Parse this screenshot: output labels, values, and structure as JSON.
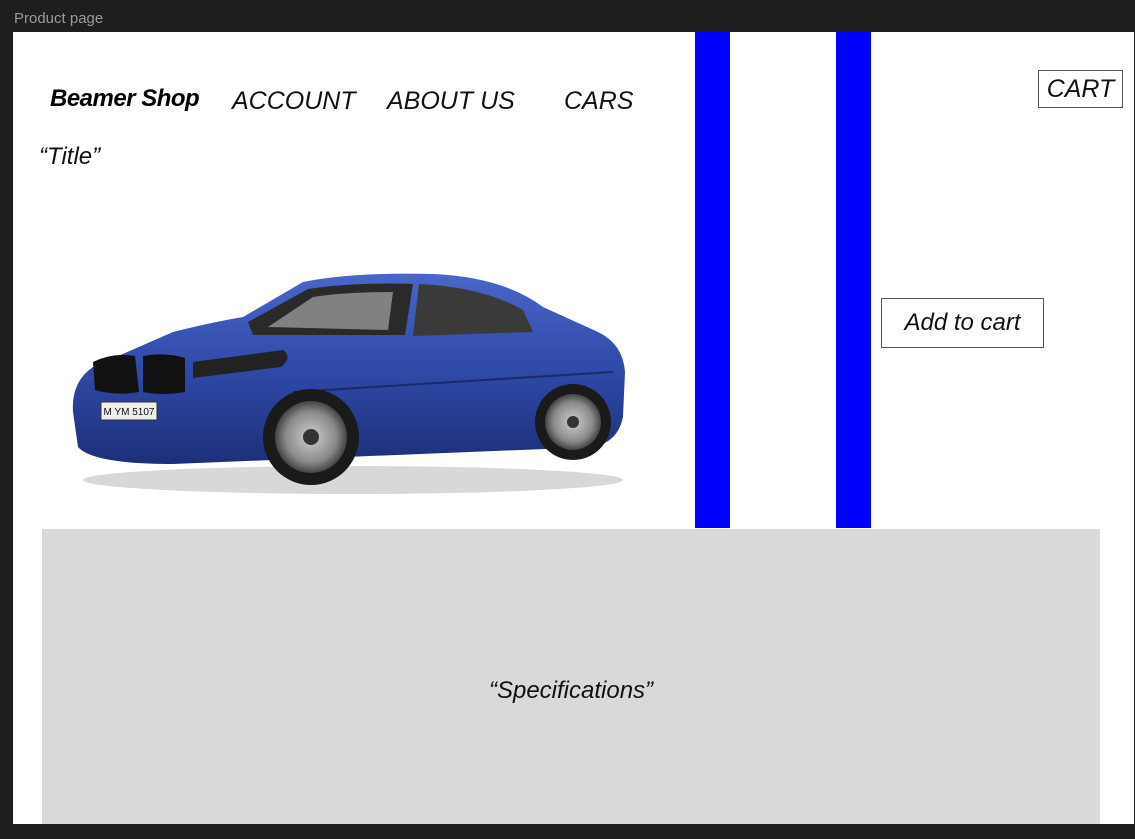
{
  "frame": {
    "label": "Product page"
  },
  "header": {
    "brand": "Beamer Shop",
    "nav": [
      "ACCOUNT",
      "ABOUT US",
      "CARS"
    ],
    "cart_label": "CART"
  },
  "main": {
    "title": "“Title”",
    "add_to_cart_label": "Add to cart",
    "car_plate": "M YM 5107",
    "specifications_label": "“Specifications”"
  },
  "colors": {
    "stripe": "#0000ff",
    "car_body": "#2f4aa8",
    "specs_bg": "#d9d9d9"
  }
}
